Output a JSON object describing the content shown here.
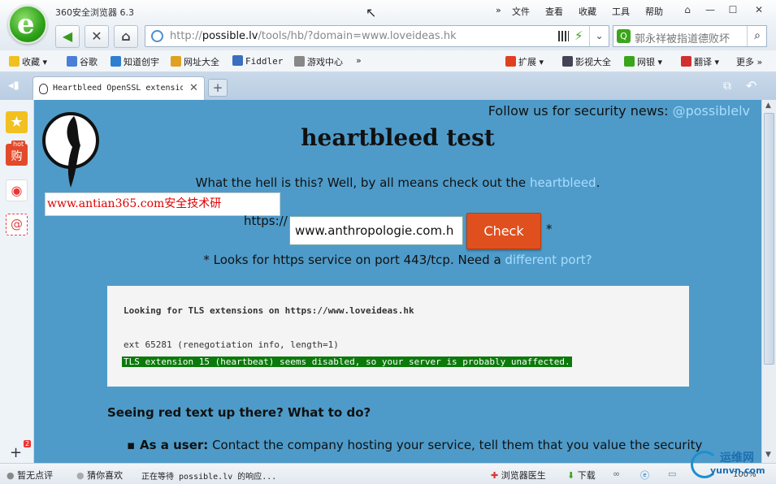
{
  "window": {
    "app_title": "360安全浏览器 6.3",
    "menu": [
      "文件",
      "查看",
      "收藏",
      "工具",
      "帮助"
    ]
  },
  "nav": {
    "url_prefix": "http://",
    "url_domain": "possible.lv",
    "url_path": "/tools/hb/?domain=www.loveideas.hk",
    "search_text": "郭永祥被指道德败坏"
  },
  "bookmarks": {
    "items": [
      "收藏",
      "谷歌",
      "知道创宇",
      "网址大全",
      "Fiddler",
      "游戏中心"
    ],
    "right_items": [
      "扩展",
      "影视大全",
      "网银",
      "翻译",
      "更多"
    ]
  },
  "tab": {
    "title": "Heartbleed OpenSSL extension"
  },
  "sidebar": {
    "hot_badge": "hot",
    "badge_count": "2"
  },
  "page": {
    "follow_text": "Follow us for security news:",
    "follow_link": "@possiblelv",
    "heading": "heartbleed test",
    "intro_text": "What the hell is this? Well, by all means check out the",
    "intro_link": "heartbleed",
    "intro_end": ".",
    "host_prefix": "https://",
    "host_value": "www.anthropologie.com.h",
    "check_label": "Check",
    "asterisk": "*",
    "looks_text": "* Looks for https service on port 443/tcp. Need a",
    "looks_link": "different port?",
    "result_line1": "Looking for TLS extensions on https://www.loveideas.hk",
    "result_line2": "ext 65281 (renegotiation info, length=1)",
    "result_line3": "TLS extension 15 (heartbeat) seems disabled, so your server is probably unaffected.",
    "seeing_heading": "Seeing red text up there? What to do?",
    "bullet_bold": "As a user:",
    "bullet_text": "Contact the company hosting your service, tell them that you value the security",
    "watermark": "www.antian365.com安全技术研"
  },
  "status": {
    "left1": "暂无点评",
    "left2": "猜你喜欢",
    "loading": "正在等待 possible.lv 的响应...",
    "doctor": "浏览器医生",
    "download": "下载",
    "zoom": "100%",
    "corner_logo": "运维网",
    "corner_url": "yunvn.com"
  },
  "colors": {
    "page_bg": "#4e9bc9",
    "link": "#a9dcff",
    "check_btn": "#e0501e",
    "ok_highlight": "#0b7a0b"
  }
}
